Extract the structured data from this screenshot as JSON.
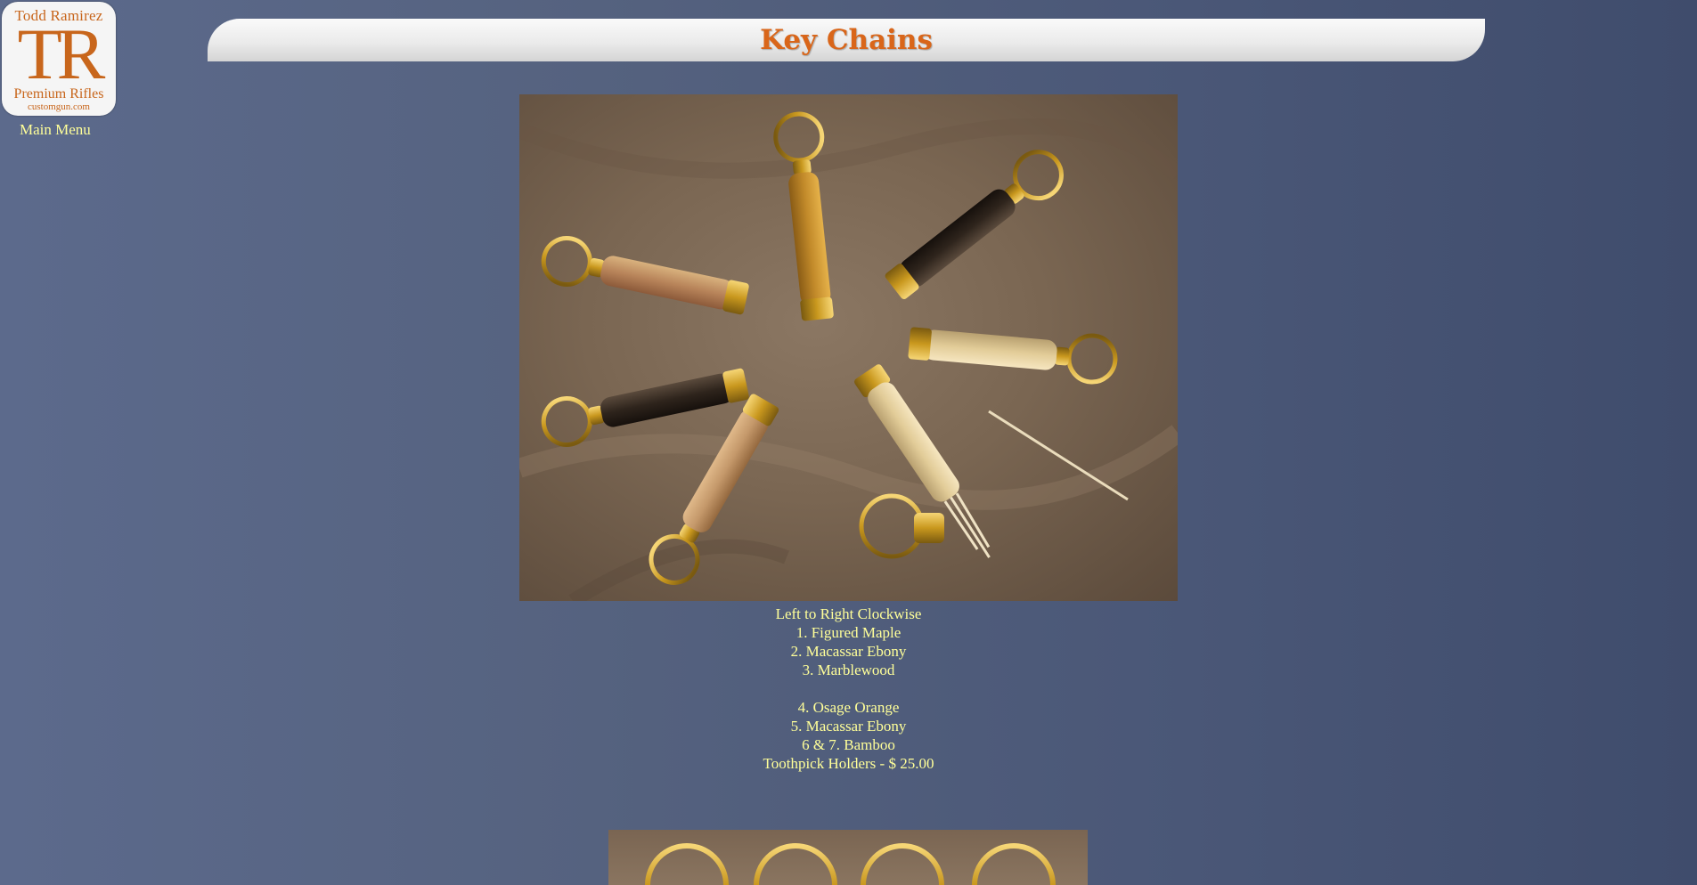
{
  "logo": {
    "brand_name": "Todd Ramirez",
    "monogram": "TR",
    "tagline": "Premium Rifles",
    "domain": "customgun.com",
    "color": "#c8661c"
  },
  "nav": {
    "main_menu_label": "Main Menu"
  },
  "header": {
    "title": "Key Chains",
    "title_color": "#d9661a"
  },
  "gallery": {
    "caption_lines": [
      "Left to Right Clockwise",
      "1. Figured Maple",
      "2. Macassar Ebony",
      "3. Marblewood",
      "",
      "4. Osage Orange",
      "5. Macassar Ebony",
      "6 & 7. Bamboo",
      "Toothpick Holders - $ 25.00"
    ]
  },
  "colors": {
    "link": "#ffff99",
    "background": "#4f5b7b"
  }
}
